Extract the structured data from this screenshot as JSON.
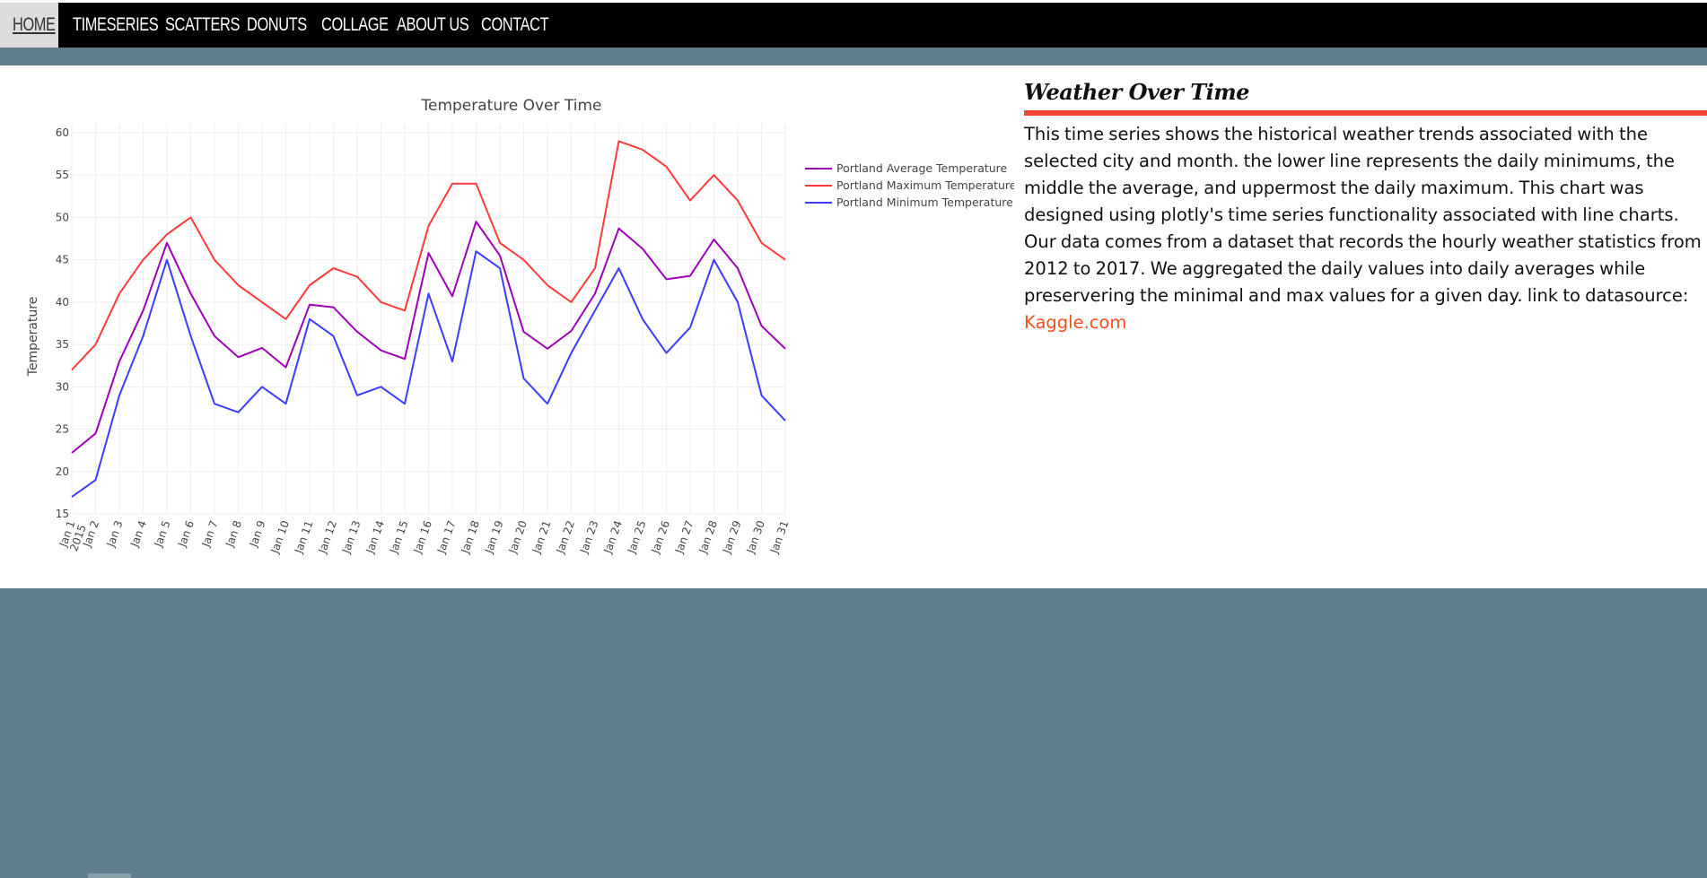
{
  "nav": {
    "items": [
      {
        "label": "HOME",
        "active": true
      },
      {
        "label": "TIMESERIES",
        "active": false
      },
      {
        "label": "SCATTERS",
        "active": false
      },
      {
        "label": "DONUTS",
        "active": false
      },
      {
        "label": "COLLAGE",
        "active": false
      },
      {
        "label": "ABOUT US",
        "active": false
      },
      {
        "label": "CONTACT",
        "active": false
      }
    ]
  },
  "article": {
    "title": "Weather Over Time",
    "body": "This time series shows the historical weather trends associated with the selected city and month. the lower line represents the daily minimums, the middle the average, and uppermost the daily maximum. This chart was designed using plotly's time series functionality associated with line charts. Our data comes from a dataset that records the hourly weather statistics from 2012 to 2017. We aggregated the daily values into daily averages while preservering the minimal and max values for a given day. link to datasource: ",
    "link_text": "Kaggle.com"
  },
  "colors": {
    "nav_bg": "#000000",
    "page_bg": "#607d8b",
    "accent": "#f44336",
    "link": "#f4511e"
  },
  "chart_data": {
    "type": "line",
    "title": "Temperature Over Time",
    "xlabel": "",
    "ylabel": "Temperature",
    "ylim": [
      15,
      60
    ],
    "yticks": [
      15,
      20,
      25,
      30,
      35,
      40,
      45,
      50,
      55,
      60
    ],
    "grid": true,
    "legend_position": "top-right",
    "categories": [
      "Jan 1\n2015",
      "Jan 2",
      "Jan 3",
      "Jan 4",
      "Jan 5",
      "Jan 6",
      "Jan 7",
      "Jan 8",
      "Jan 9",
      "Jan 10",
      "Jan 11",
      "Jan 12",
      "Jan 13",
      "Jan 14",
      "Jan 15",
      "Jan 16",
      "Jan 17",
      "Jan 18",
      "Jan 19",
      "Jan 20",
      "Jan 21",
      "Jan 22",
      "Jan 23",
      "Jan 24",
      "Jan 25",
      "Jan 26",
      "Jan 27",
      "Jan 28",
      "Jan 29",
      "Jan 30",
      "Jan 31"
    ],
    "series": [
      {
        "name": "Portland Average Temperature",
        "color": "#9c00b5",
        "values": [
          22.2,
          24.5,
          33,
          39,
          47,
          41,
          36,
          33.5,
          34.6,
          32.3,
          39.7,
          39.4,
          36.5,
          34.3,
          33.3,
          45.8,
          40.7,
          49.5,
          45.5,
          36.5,
          34.5,
          36.6,
          41,
          48.7,
          46.3,
          42.7,
          43.1,
          47.4,
          44,
          37.2,
          34.5
        ]
      },
      {
        "name": "Portland Maximum Temperature",
        "color": "#ff3b3b",
        "values": [
          32,
          35,
          41,
          45,
          48,
          50,
          45,
          42,
          40,
          38,
          42,
          44,
          43,
          40,
          39,
          49,
          54,
          54,
          47,
          45,
          42,
          40,
          44,
          59,
          58,
          56,
          52,
          55,
          52,
          47,
          45
        ]
      },
      {
        "name": "Portland Minimum Temperature",
        "color": "#3c3cff",
        "values": [
          17,
          19,
          29,
          36,
          45,
          36,
          28,
          27,
          30,
          28,
          38,
          36,
          29,
          30,
          28,
          41,
          33,
          46,
          44,
          31,
          28,
          34,
          39,
          44,
          38,
          34,
          37,
          45,
          40,
          29,
          26
        ]
      }
    ]
  }
}
